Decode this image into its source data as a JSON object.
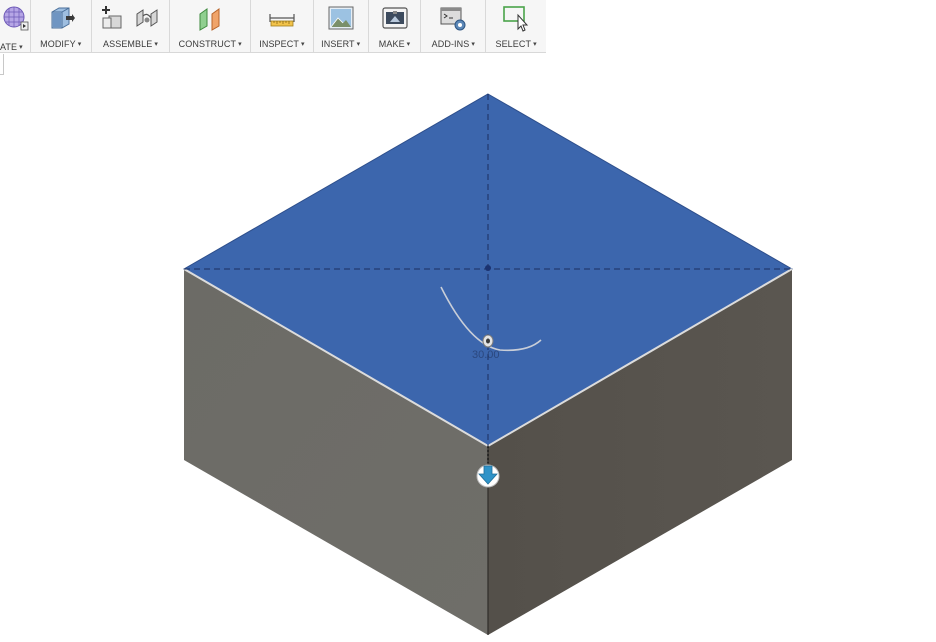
{
  "toolbar": {
    "groups": [
      {
        "id": "create",
        "label": "ATE"
      },
      {
        "id": "modify",
        "label": "MODIFY"
      },
      {
        "id": "assemble",
        "label": "ASSEMBLE"
      },
      {
        "id": "construct",
        "label": "CONSTRUCT"
      },
      {
        "id": "inspect",
        "label": "INSPECT"
      },
      {
        "id": "insert",
        "label": "INSERT"
      },
      {
        "id": "make",
        "label": "MAKE"
      },
      {
        "id": "addins",
        "label": "ADD-INS"
      },
      {
        "id": "select",
        "label": "SELECT"
      }
    ],
    "caret": "▾"
  },
  "viewport": {
    "dimension_value": "30.00",
    "colors": {
      "top_face": "#3c66ad",
      "front_left_face": "#6e6d68",
      "front_right_face": "#57534d",
      "edge_highlight": "#e2e2e2",
      "arrow_handle": "#2f93c8"
    }
  }
}
